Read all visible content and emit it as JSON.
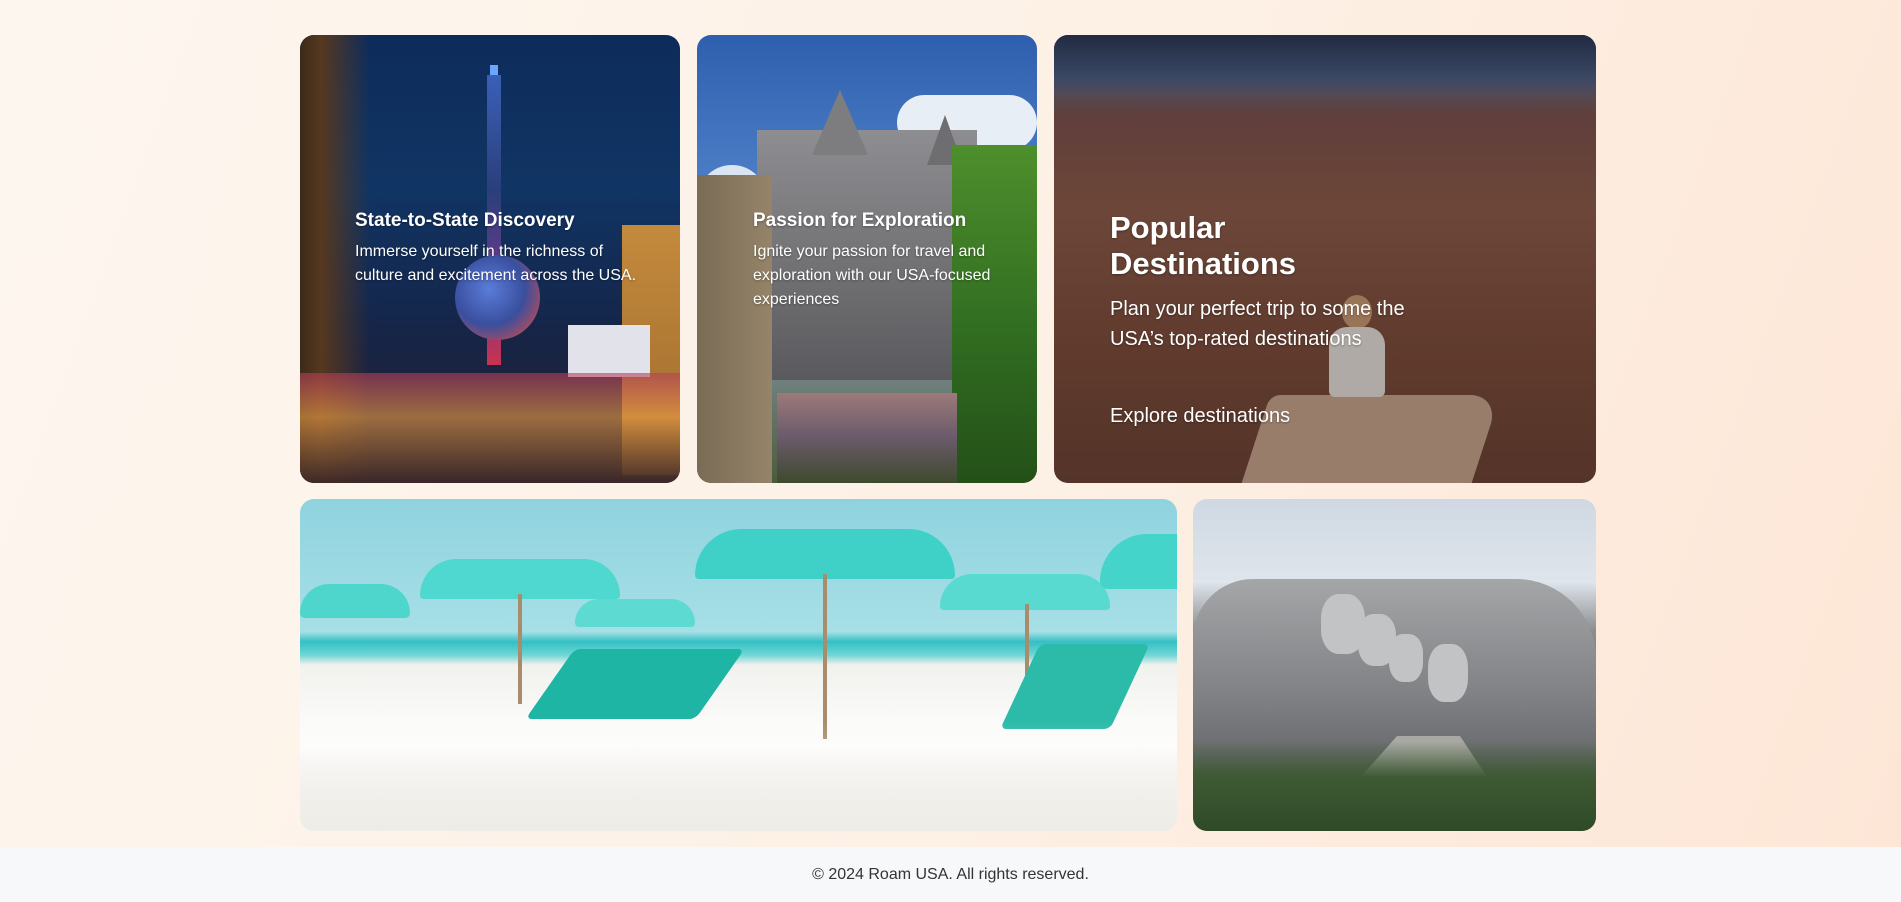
{
  "cards": [
    {
      "title": "State-to-State Discovery",
      "description": "Immerse yourself in the richness of culture and excitement across the USA."
    },
    {
      "title": "Passion for Exploration",
      "description": "Ignite your passion for travel and exploration with our USA-focused experiences"
    },
    {
      "title": "Popular Destinations",
      "description": "Plan your perfect trip to some the USA’s top-rated destinations",
      "link_label": "Explore destinations"
    }
  ],
  "images": {
    "card1": "las-vegas-night-skyline",
    "card2": "castle-theme-park",
    "card3": "grand-canyon-person-sitting",
    "card4": "beach-umbrellas-lounge-chairs",
    "card5": "mount-rushmore"
  },
  "footer": {
    "copyright": "© 2024 Roam USA. All rights reserved."
  },
  "colors": {
    "page_background": "#fdf3ea",
    "footer_background": "#f7f8fa",
    "card_text": "#ffffff"
  }
}
